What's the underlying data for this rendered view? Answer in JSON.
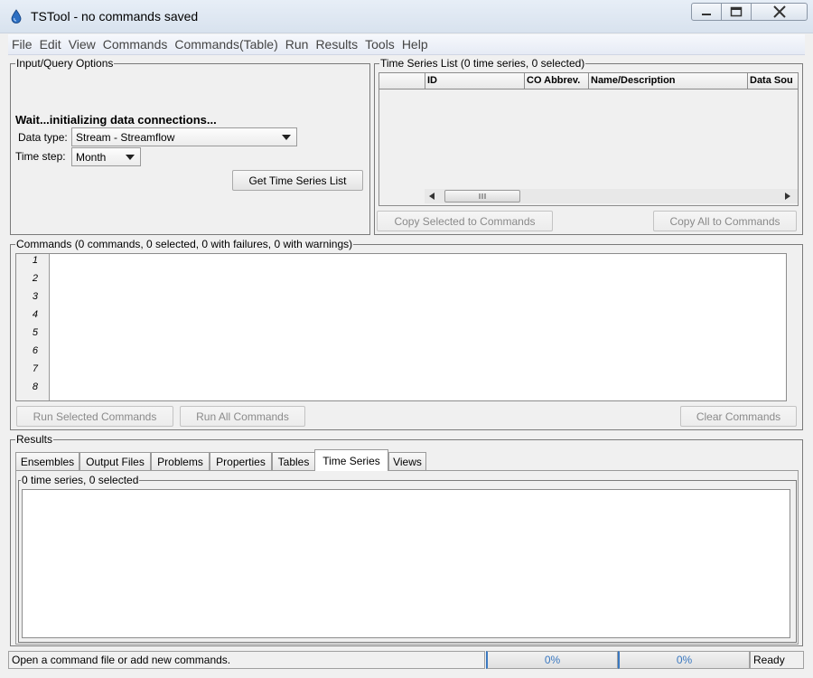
{
  "window": {
    "title": "TSTool - no commands saved"
  },
  "menu": [
    "File",
    "Edit",
    "View",
    "Commands",
    "Commands(Table)",
    "Run",
    "Results",
    "Tools",
    "Help"
  ],
  "input_query": {
    "label": "Input/Query Options",
    "wait_message": "Wait...initializing data connections...",
    "data_type_label": "Data type:",
    "data_type_value": "Stream - Streamflow",
    "time_step_label": "Time step:",
    "time_step_value": "Month",
    "get_list_button": "Get Time Series List"
  },
  "ts_list": {
    "label": "Time Series List (0 time series, 0 selected)",
    "columns": [
      "ID",
      "CO Abbrev.",
      "Name/Description",
      "Data Sou"
    ],
    "copy_selected_button": "Copy Selected to Commands",
    "copy_all_button": "Copy All to Commands"
  },
  "commands": {
    "label": "Commands (0 commands, 0 selected, 0 with failures, 0 with warnings)",
    "line_numbers": [
      "1",
      "2",
      "3",
      "4",
      "5",
      "6",
      "7",
      "8"
    ],
    "run_selected_button": "Run Selected Commands",
    "run_all_button": "Run All Commands",
    "clear_button": "Clear Commands"
  },
  "results": {
    "label": "Results",
    "tabs": [
      "Ensembles",
      "Output Files",
      "Problems",
      "Properties",
      "Tables",
      "Time Series",
      "Views"
    ],
    "active_tab": "Time Series",
    "inner_label": "0 time series, 0 selected"
  },
  "status": {
    "message": "Open a command file or add new commands.",
    "progress1": "0%",
    "progress2": "0%",
    "state": "Ready"
  }
}
